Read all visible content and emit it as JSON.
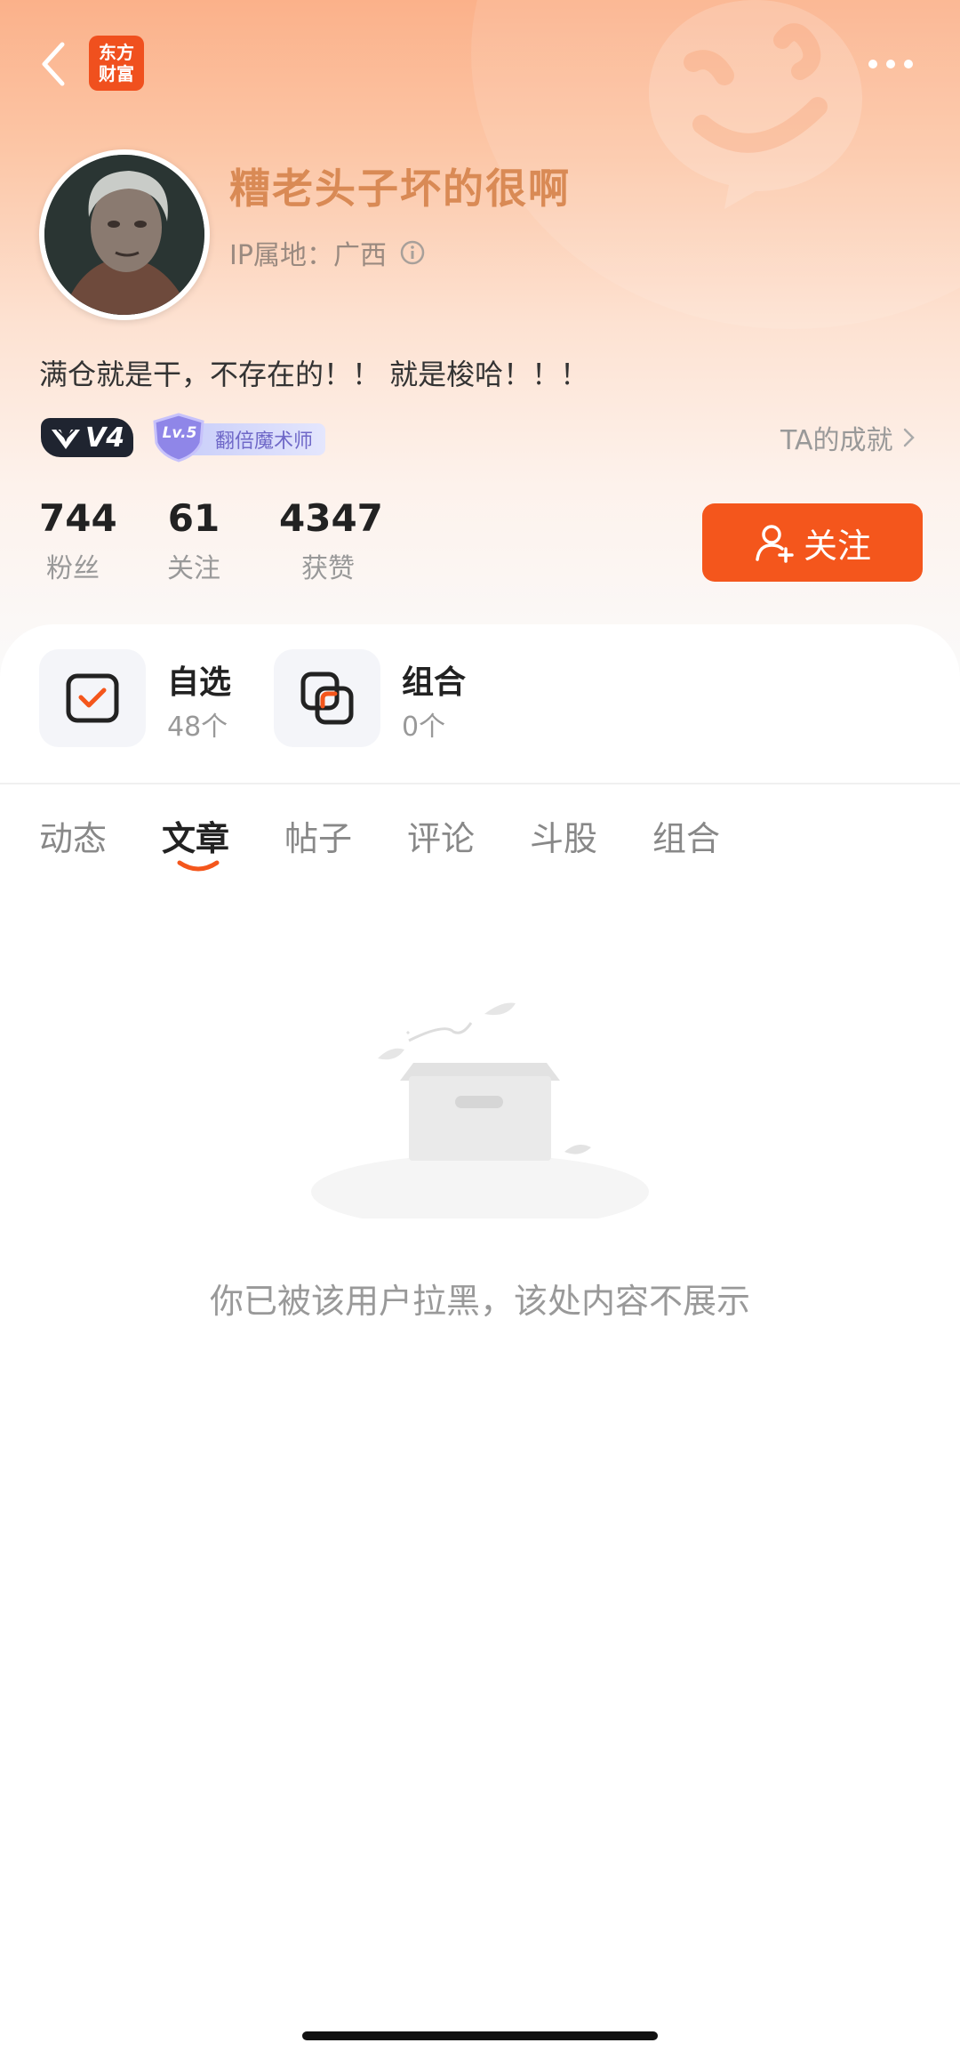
{
  "app": {
    "logo_text": "东方财富",
    "accent_color": "#f4561c"
  },
  "nav": {
    "back_icon": "chevron-left-icon",
    "more_icon": "more-dots-icon"
  },
  "profile": {
    "username": "糟老头子坏的很啊",
    "ip_location": "IP属地：广西",
    "bio": "满仓就是干，不存在的！！ 就是梭哈！！！",
    "v_level": "V4",
    "badge_level": "Lv.5",
    "badge_title": "翻倍魔术师",
    "achievements_link": "TA的成就"
  },
  "stats": [
    {
      "value": "744",
      "label": "粉丝"
    },
    {
      "value": "61",
      "label": "关注"
    },
    {
      "value": "4347",
      "label": "获赞"
    }
  ],
  "follow_button": {
    "label": "关注"
  },
  "quick_links": [
    {
      "title": "自选",
      "count": "48个",
      "icon": "checkbox-icon"
    },
    {
      "title": "组合",
      "count": "0个",
      "icon": "overlap-squares-icon"
    }
  ],
  "tabs": [
    "动态",
    "文章",
    "帖子",
    "评论",
    "斗股",
    "组合"
  ],
  "active_tab": "文章",
  "empty_state": {
    "message": "你已被该用户拉黑，该处内容不展示",
    "icon": "empty-box-icon"
  }
}
